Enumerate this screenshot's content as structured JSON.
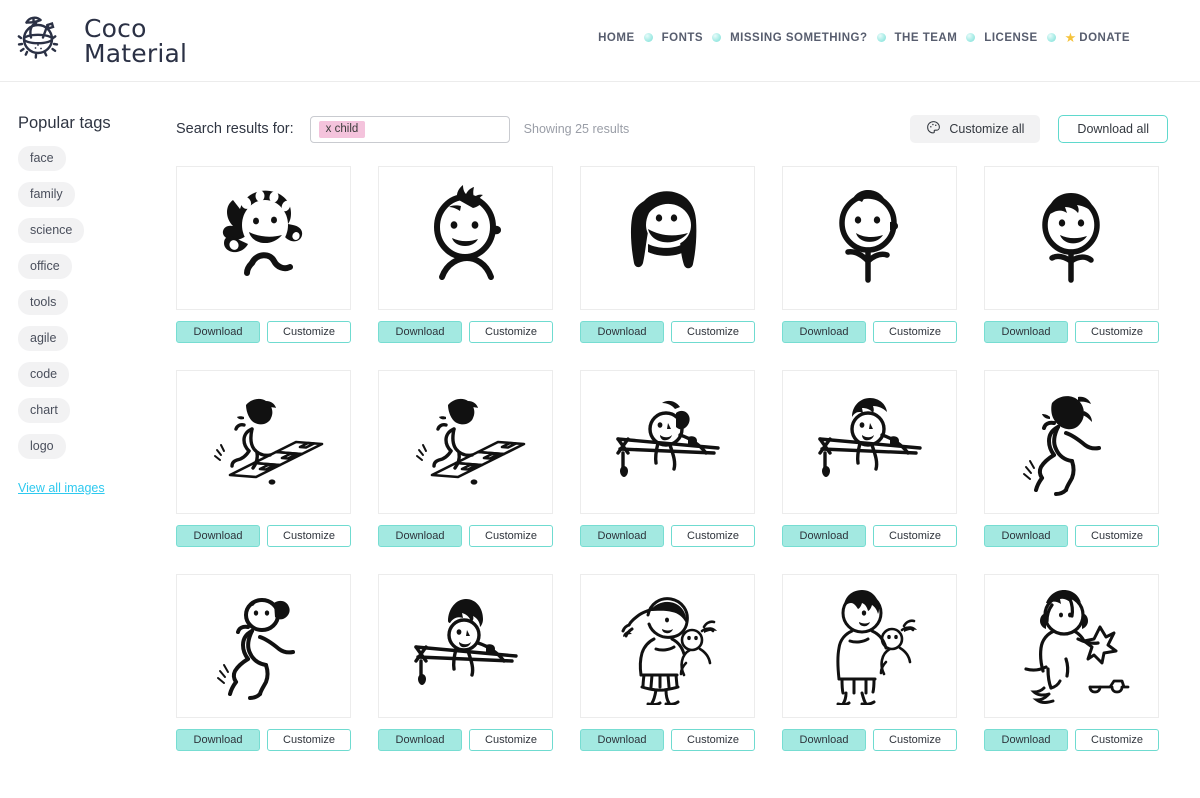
{
  "brand": {
    "name_line1": "Coco",
    "name_line2": "Material",
    "logo_icon": "coconut-drink-icon"
  },
  "nav": {
    "items": [
      {
        "label": "HOME"
      },
      {
        "label": "FONTS"
      },
      {
        "label": "MISSING SOMETHING?"
      },
      {
        "label": "THE TEAM"
      },
      {
        "label": "LICENSE"
      },
      {
        "label": "DONATE",
        "icon": "star-icon",
        "star": "★"
      }
    ],
    "separator_icon": "dot-separator-icon"
  },
  "sidebar": {
    "title": "Popular tags",
    "tags": [
      {
        "label": "face"
      },
      {
        "label": "family"
      },
      {
        "label": "science"
      },
      {
        "label": "office"
      },
      {
        "label": "tools"
      },
      {
        "label": "agile"
      },
      {
        "label": "code"
      },
      {
        "label": "chart"
      },
      {
        "label": "logo"
      }
    ],
    "view_all_label": "View all images"
  },
  "toolbar": {
    "search_label": "Search results for:",
    "search_chip": "x child",
    "search_placeholder": "",
    "results_text": "Showing 25 results",
    "customize_all_label": "Customize all",
    "customize_all_icon": "palette-icon",
    "download_all_label": "Download all"
  },
  "card_actions": {
    "download_label": "Download",
    "customize_label": "Customize"
  },
  "colors": {
    "accent_teal": "#a3e9e1",
    "accent_teal_border": "#6fdbd0",
    "link_cyan": "#2ec9ef",
    "chip_pink": "#f4c3dc",
    "tag_grey": "#f2f2f3",
    "text_dark": "#2f3542",
    "muted": "#9a9ea7",
    "star_yellow": "#f5c33b",
    "logo_navy": "#2b3145"
  },
  "grid": {
    "items": [
      {
        "name": "girl-curly-hair-smiling",
        "icon": "girl-face-icon"
      },
      {
        "name": "baby-tuft-hair-face",
        "icon": "baby-face-icon"
      },
      {
        "name": "girl-long-hair-laughing",
        "icon": "girl-long-hair-icon"
      },
      {
        "name": "boy-short-hair-waving",
        "icon": "boy-face-icon"
      },
      {
        "name": "boy-dark-hair-smiling",
        "icon": "boy-dark-hair-icon"
      },
      {
        "name": "child-playing-hopscotch-1",
        "icon": "hopscotch-icon"
      },
      {
        "name": "child-playing-hopscotch-2",
        "icon": "hopscotch-icon"
      },
      {
        "name": "girl-leaning-on-fence",
        "icon": "child-fence-icon"
      },
      {
        "name": "boy-leaning-on-fence",
        "icon": "child-fence-icon"
      },
      {
        "name": "child-running-messy-hair",
        "icon": "running-child-icon"
      },
      {
        "name": "child-running-ponytail",
        "icon": "running-child-icon"
      },
      {
        "name": "boy-afro-leaning-on-fence",
        "icon": "child-fence-icon"
      },
      {
        "name": "girl-braid-holding-doll",
        "icon": "child-doll-icon"
      },
      {
        "name": "boy-holding-doll",
        "icon": "child-doll-icon"
      },
      {
        "name": "child-playing-with-toys",
        "icon": "child-toys-icon"
      }
    ]
  }
}
